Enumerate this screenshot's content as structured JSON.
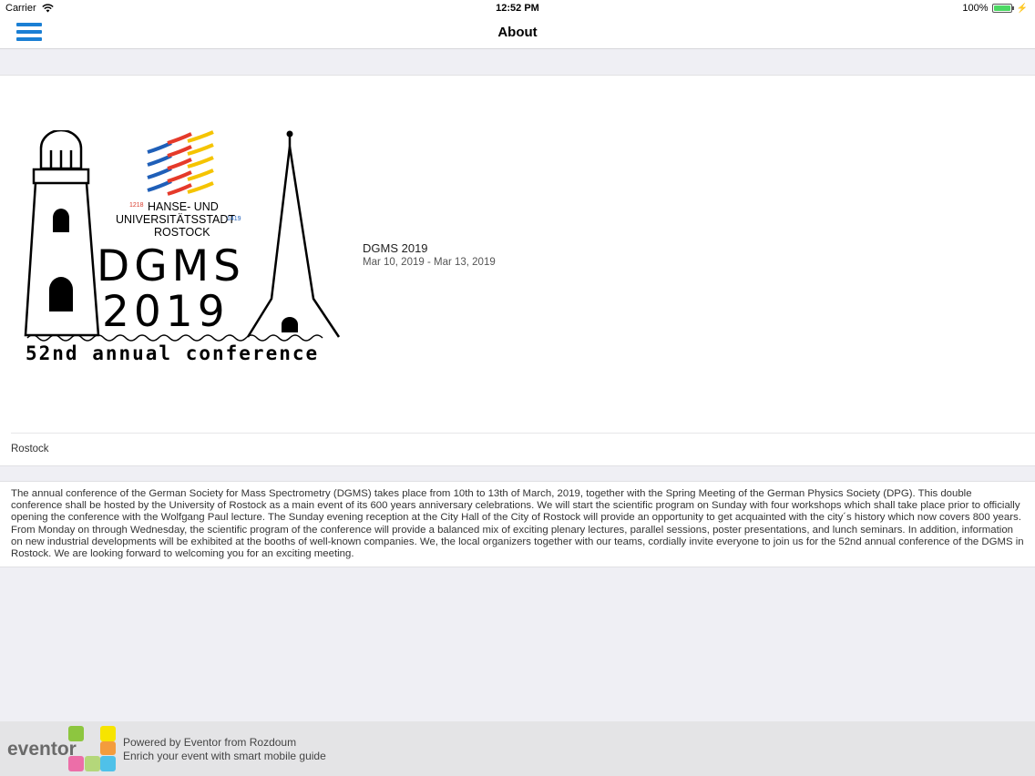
{
  "status_bar": {
    "carrier": "Carrier",
    "time": "12:52 PM",
    "battery": "100%",
    "battery_level": 1.0,
    "icons": [
      "wifi-icon",
      "battery-icon",
      "charging-icon"
    ]
  },
  "nav": {
    "title": "About",
    "menu_icon": "hamburger-menu-icon",
    "accent_color": "#1a7fd4"
  },
  "event": {
    "logo": {
      "year_left": "1218",
      "year_right": "1419",
      "city_line1": "HANSE- UND",
      "city_line2": "UNIVERSITÄTSSTADT",
      "city_line3": "ROSTOCK",
      "acronym": "DGMS",
      "year": "2019",
      "tagline": "52nd annual conference",
      "stripe_colors": [
        "#1f5fb8",
        "#e53a2a",
        "#f5c400"
      ]
    },
    "title": "DGMS 2019",
    "dates": "Mar 10, 2019 - Mar 13, 2019",
    "location": "Rostock"
  },
  "description": "The annual conference of the German Society for Mass Spectrometry (DGMS) takes place from 10th to 13th of March, 2019, together with the Spring Meeting of the German Physics Society (DPG). This double conference shall be hosted by the University of Rostock as a main event of its 600 years anniversary celebrations. We will start the scientific program on Sunday with four workshops which shall take place prior to officially opening the conference with the Wolfgang Paul lecture. The Sunday evening reception at the City Hall of the City of Rostock will provide an opportunity to get acquainted with the city´s history which now covers 800 years. From Monday on through Wednesday, the scientific program of the conference will provide a balanced mix of exciting plenary lectures, parallel sessions, poster presentations, and lunch seminars. In addition, information on new industrial developments will be exhibited at the booths of well-known companies. We, the local organizers together with our teams, cordially invite everyone to join us for the 52nd annual conference of the DGMS in Rostock. We are looking forward to welcoming you for an exciting meeting.",
  "footer": {
    "logo_text": "eventor",
    "powered_by": "Powered by Eventor from Rozdoum",
    "tagline": "Enrich your event with smart mobile guide",
    "tile_colors": [
      "#8dc63f",
      "#f7e400",
      "#f39c3d",
      "#ec6ea8",
      "#4fc1e9",
      "#b4d77a"
    ]
  }
}
